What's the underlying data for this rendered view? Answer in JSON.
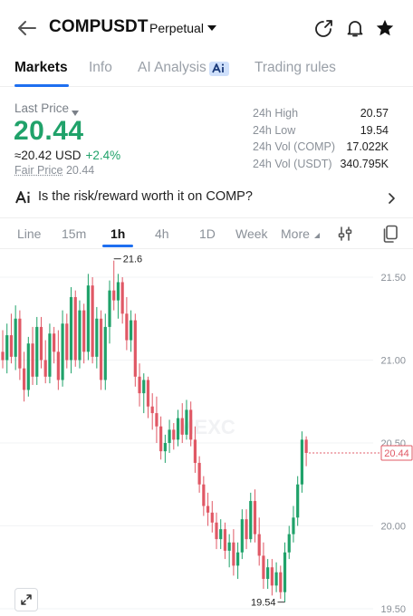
{
  "header": {
    "symbol": "COMPUSDT",
    "contract_type": "Perpetual"
  },
  "tabs": [
    {
      "label": "Markets",
      "active": true
    },
    {
      "label": "Info",
      "active": false
    },
    {
      "label": "AI Analysis",
      "active": false
    },
    {
      "label": "Trading rules",
      "active": false
    }
  ],
  "price_block": {
    "label": "Last Price",
    "price": "20.44",
    "usd_value": "≈20.42 USD",
    "change": "+2.4%",
    "fair_price_label": "Fair Price",
    "fair_price": "20.44"
  },
  "stats": [
    {
      "label": "24h High",
      "value": "20.57"
    },
    {
      "label": "24h Low",
      "value": "19.54"
    },
    {
      "label": "24h Vol (COMP)",
      "value": "17.022K"
    },
    {
      "label": "24h Vol (USDT)",
      "value": "340.795K"
    }
  ],
  "ai_prompt": {
    "text": "Is the risk/reward worth it on COMP?"
  },
  "intervals": [
    {
      "label": "Line",
      "active": false
    },
    {
      "label": "15m",
      "active": false
    },
    {
      "label": "1h",
      "active": true
    },
    {
      "label": "4h",
      "active": false
    },
    {
      "label": "1D",
      "active": false
    },
    {
      "label": "Week",
      "active": false
    },
    {
      "label": "More",
      "active": false
    }
  ],
  "colors": {
    "up": "#20a26a",
    "down": "#e05865",
    "accent": "#1e6ff0"
  },
  "chart_data": {
    "type": "candlestick",
    "interval": "1h",
    "y_ticks": [
      "21.50",
      "21.00",
      "20.50",
      "20.00",
      "19.50"
    ],
    "ylim": [
      19.45,
      21.75
    ],
    "high_marker": "21.6",
    "low_marker": "19.54",
    "current_price_tag": "20.44",
    "watermark": "MEXC",
    "candles": [
      {
        "o": 21.05,
        "h": 21.18,
        "l": 20.95,
        "c": 21.0
      },
      {
        "o": 21.0,
        "h": 21.22,
        "l": 20.92,
        "c": 21.15
      },
      {
        "o": 21.15,
        "h": 21.28,
        "l": 20.98,
        "c": 21.02
      },
      {
        "o": 21.02,
        "h": 21.33,
        "l": 20.94,
        "c": 21.25
      },
      {
        "o": 21.25,
        "h": 21.3,
        "l": 20.88,
        "c": 20.95
      },
      {
        "o": 20.95,
        "h": 21.05,
        "l": 20.75,
        "c": 20.82
      },
      {
        "o": 20.82,
        "h": 21.14,
        "l": 20.78,
        "c": 21.1
      },
      {
        "o": 21.1,
        "h": 21.2,
        "l": 20.85,
        "c": 20.9
      },
      {
        "o": 20.9,
        "h": 21.26,
        "l": 20.85,
        "c": 21.2
      },
      {
        "o": 21.2,
        "h": 21.26,
        "l": 20.95,
        "c": 21.0
      },
      {
        "o": 21.0,
        "h": 21.12,
        "l": 20.86,
        "c": 20.9
      },
      {
        "o": 20.9,
        "h": 21.22,
        "l": 20.86,
        "c": 21.16
      },
      {
        "o": 21.16,
        "h": 21.2,
        "l": 20.98,
        "c": 21.05
      },
      {
        "o": 21.05,
        "h": 21.18,
        "l": 20.82,
        "c": 20.88
      },
      {
        "o": 20.88,
        "h": 21.3,
        "l": 20.84,
        "c": 21.22
      },
      {
        "o": 21.22,
        "h": 21.28,
        "l": 20.95,
        "c": 21.0
      },
      {
        "o": 21.0,
        "h": 21.44,
        "l": 20.92,
        "c": 21.38
      },
      {
        "o": 21.38,
        "h": 21.42,
        "l": 20.96,
        "c": 21.0
      },
      {
        "o": 21.0,
        "h": 21.36,
        "l": 20.95,
        "c": 21.3
      },
      {
        "o": 21.3,
        "h": 21.34,
        "l": 20.98,
        "c": 21.05
      },
      {
        "o": 21.05,
        "h": 21.52,
        "l": 21.0,
        "c": 21.45
      },
      {
        "o": 21.45,
        "h": 21.5,
        "l": 20.98,
        "c": 21.02
      },
      {
        "o": 21.02,
        "h": 21.32,
        "l": 20.95,
        "c": 21.25
      },
      {
        "o": 21.25,
        "h": 21.3,
        "l": 20.82,
        "c": 20.88
      },
      {
        "o": 20.88,
        "h": 21.28,
        "l": 20.82,
        "c": 21.2
      },
      {
        "o": 21.2,
        "h": 21.48,
        "l": 21.1,
        "c": 21.42
      },
      {
        "o": 21.42,
        "h": 21.6,
        "l": 21.3,
        "c": 21.36
      },
      {
        "o": 21.36,
        "h": 21.52,
        "l": 21.25,
        "c": 21.47
      },
      {
        "o": 21.47,
        "h": 21.5,
        "l": 21.22,
        "c": 21.28
      },
      {
        "o": 21.28,
        "h": 21.38,
        "l": 21.06,
        "c": 21.12
      },
      {
        "o": 21.12,
        "h": 21.3,
        "l": 21.05,
        "c": 21.24
      },
      {
        "o": 21.24,
        "h": 21.28,
        "l": 20.84,
        "c": 20.9
      },
      {
        "o": 20.9,
        "h": 20.98,
        "l": 20.72,
        "c": 20.8
      },
      {
        "o": 20.8,
        "h": 20.92,
        "l": 20.68,
        "c": 20.88
      },
      {
        "o": 20.88,
        "h": 20.9,
        "l": 20.65,
        "c": 20.72
      },
      {
        "o": 20.72,
        "h": 20.8,
        "l": 20.58,
        "c": 20.68
      },
      {
        "o": 20.68,
        "h": 20.78,
        "l": 20.5,
        "c": 20.6
      },
      {
        "o": 20.6,
        "h": 20.66,
        "l": 20.4,
        "c": 20.45
      },
      {
        "o": 20.45,
        "h": 20.55,
        "l": 20.38,
        "c": 20.5
      },
      {
        "o": 20.5,
        "h": 20.64,
        "l": 20.44,
        "c": 20.58
      },
      {
        "o": 20.58,
        "h": 20.62,
        "l": 20.46,
        "c": 20.52
      },
      {
        "o": 20.52,
        "h": 20.7,
        "l": 20.48,
        "c": 20.65
      },
      {
        "o": 20.65,
        "h": 20.74,
        "l": 20.5,
        "c": 20.55
      },
      {
        "o": 20.55,
        "h": 20.76,
        "l": 20.52,
        "c": 20.7
      },
      {
        "o": 20.7,
        "h": 20.75,
        "l": 20.48,
        "c": 20.52
      },
      {
        "o": 20.52,
        "h": 20.6,
        "l": 20.32,
        "c": 20.38
      },
      {
        "o": 20.38,
        "h": 20.42,
        "l": 20.2,
        "c": 20.25
      },
      {
        "o": 20.25,
        "h": 20.3,
        "l": 20.06,
        "c": 20.12
      },
      {
        "o": 20.12,
        "h": 20.2,
        "l": 20.0,
        "c": 20.08
      },
      {
        "o": 20.08,
        "h": 20.15,
        "l": 19.96,
        "c": 20.02
      },
      {
        "o": 20.02,
        "h": 20.08,
        "l": 19.86,
        "c": 19.92
      },
      {
        "o": 19.92,
        "h": 20.04,
        "l": 19.86,
        "c": 19.98
      },
      {
        "o": 19.98,
        "h": 20.02,
        "l": 19.8,
        "c": 19.85
      },
      {
        "o": 19.85,
        "h": 19.95,
        "l": 19.75,
        "c": 19.9
      },
      {
        "o": 19.9,
        "h": 19.98,
        "l": 19.7,
        "c": 19.76
      },
      {
        "o": 19.76,
        "h": 19.9,
        "l": 19.68,
        "c": 19.84
      },
      {
        "o": 19.84,
        "h": 20.1,
        "l": 19.8,
        "c": 20.04
      },
      {
        "o": 20.04,
        "h": 20.1,
        "l": 19.86,
        "c": 19.92
      },
      {
        "o": 19.92,
        "h": 20.2,
        "l": 19.9,
        "c": 20.15
      },
      {
        "o": 20.15,
        "h": 20.22,
        "l": 19.9,
        "c": 19.95
      },
      {
        "o": 19.95,
        "h": 20.05,
        "l": 19.76,
        "c": 19.82
      },
      {
        "o": 19.82,
        "h": 19.9,
        "l": 19.62,
        "c": 19.68
      },
      {
        "o": 19.68,
        "h": 19.8,
        "l": 19.62,
        "c": 19.75
      },
      {
        "o": 19.75,
        "h": 19.8,
        "l": 19.58,
        "c": 19.64
      },
      {
        "o": 19.64,
        "h": 19.78,
        "l": 19.6,
        "c": 19.72
      },
      {
        "o": 19.72,
        "h": 19.76,
        "l": 19.56,
        "c": 19.6
      },
      {
        "o": 19.6,
        "h": 19.9,
        "l": 19.54,
        "c": 19.84
      },
      {
        "o": 19.84,
        "h": 20.0,
        "l": 19.8,
        "c": 19.95
      },
      {
        "o": 19.95,
        "h": 20.12,
        "l": 19.9,
        "c": 20.05
      },
      {
        "o": 20.05,
        "h": 20.3,
        "l": 20.0,
        "c": 20.25
      },
      {
        "o": 20.25,
        "h": 20.57,
        "l": 20.2,
        "c": 20.52
      },
      {
        "o": 20.52,
        "h": 20.54,
        "l": 20.36,
        "c": 20.44
      }
    ]
  }
}
